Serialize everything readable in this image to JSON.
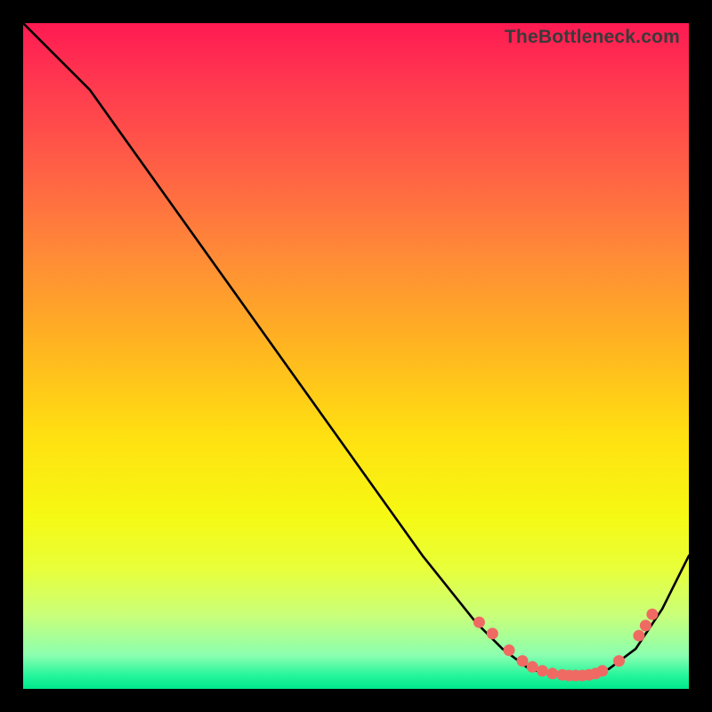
{
  "attribution": "TheBottleneck.com",
  "chart_data": {
    "type": "line",
    "title": "",
    "xlabel": "",
    "ylabel": "",
    "xlim": [
      0,
      100
    ],
    "ylim": [
      0,
      100
    ],
    "grid": false,
    "series": [
      {
        "name": "bottleneck-curve",
        "x": [
          0,
          6,
          10,
          20,
          30,
          40,
          50,
          60,
          68,
          72,
          76,
          80,
          84,
          88,
          92,
          96,
          100
        ],
        "y": [
          100,
          94,
          90,
          76,
          62,
          48,
          34,
          20,
          10,
          6,
          3,
          2,
          2,
          3,
          6,
          12,
          20
        ]
      }
    ],
    "highlight_points": {
      "name": "optimal-range-dots",
      "x": [
        68.5,
        70.5,
        73.0,
        75.0,
        76.5,
        78.0,
        79.5,
        81.0,
        82.0,
        83.0,
        84.0,
        85.0,
        86.0,
        87.0,
        89.5,
        92.5,
        93.5,
        94.5
      ],
      "y": [
        10.0,
        8.3,
        5.8,
        4.2,
        3.3,
        2.7,
        2.3,
        2.1,
        2.0,
        2.0,
        2.0,
        2.1,
        2.3,
        2.7,
        4.2,
        8.0,
        9.5,
        11.2
      ]
    }
  }
}
